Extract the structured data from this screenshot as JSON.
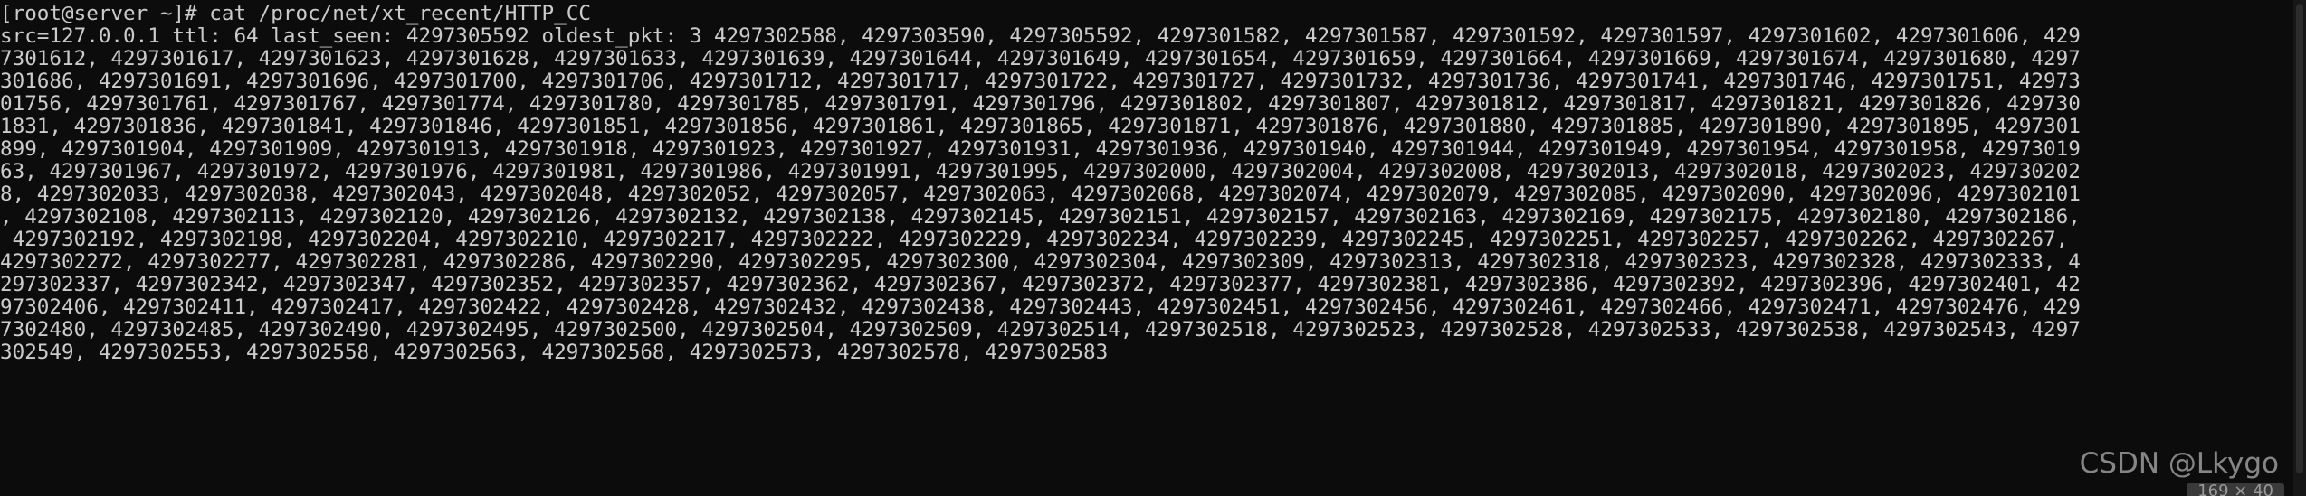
{
  "terminal": {
    "lines": [
      "[root@server ~]# cat /proc/net/xt_recent/HTTP_CC",
      "src=127.0.0.1 ttl: 64 last_seen: 4297305592 oldest_pkt: 3 4297302588, 4297303590, 4297305592, 4297301582, 4297301587, 4297301592, 4297301597, 4297301602, 4297301606, 429",
      "7301612, 4297301617, 4297301623, 4297301628, 4297301633, 4297301639, 4297301644, 4297301649, 4297301654, 4297301659, 4297301664, 4297301669, 4297301674, 4297301680, 4297",
      "301686, 4297301691, 4297301696, 4297301700, 4297301706, 4297301712, 4297301717, 4297301722, 4297301727, 4297301732, 4297301736, 4297301741, 4297301746, 4297301751, 42973",
      "01756, 4297301761, 4297301767, 4297301774, 4297301780, 4297301785, 4297301791, 4297301796, 4297301802, 4297301807, 4297301812, 4297301817, 4297301821, 4297301826, 429730",
      "1831, 4297301836, 4297301841, 4297301846, 4297301851, 4297301856, 4297301861, 4297301865, 4297301871, 4297301876, 4297301880, 4297301885, 4297301890, 4297301895, 4297301",
      "899, 4297301904, 4297301909, 4297301913, 4297301918, 4297301923, 4297301927, 4297301931, 4297301936, 4297301940, 4297301944, 4297301949, 4297301954, 4297301958, 42973019",
      "63, 4297301967, 4297301972, 4297301976, 4297301981, 4297301986, 4297301991, 4297301995, 4297302000, 4297302004, 4297302008, 4297302013, 4297302018, 4297302023, 429730202",
      "8, 4297302033, 4297302038, 4297302043, 4297302048, 4297302052, 4297302057, 4297302063, 4297302068, 4297302074, 4297302079, 4297302085, 4297302090, 4297302096, 4297302101",
      ", 4297302108, 4297302113, 4297302120, 4297302126, 4297302132, 4297302138, 4297302145, 4297302151, 4297302157, 4297302163, 4297302169, 4297302175, 4297302180, 4297302186,",
      " 4297302192, 4297302198, 4297302204, 4297302210, 4297302217, 4297302222, 4297302229, 4297302234, 4297302239, 4297302245, 4297302251, 4297302257, 4297302262, 4297302267,",
      "4297302272, 4297302277, 4297302281, 4297302286, 4297302290, 4297302295, 4297302300, 4297302304, 4297302309, 4297302313, 4297302318, 4297302323, 4297302328, 4297302333, 4",
      "297302337, 4297302342, 4297302347, 4297302352, 4297302357, 4297302362, 4297302367, 4297302372, 4297302377, 4297302381, 4297302386, 4297302392, 4297302396, 4297302401, 42",
      "97302406, 4297302411, 4297302417, 4297302422, 4297302428, 4297302432, 4297302438, 4297302443, 4297302451, 4297302456, 4297302461, 4297302466, 4297302471, 4297302476, 429",
      "7302480, 4297302485, 4297302490, 4297302495, 4297302500, 4297302504, 4297302509, 4297302514, 4297302518, 4297302523, 4297302528, 4297302533, 4297302538, 4297302543, 4297",
      "302549, 4297302553, 4297302558, 4297302563, 4297302568, 4297302573, 4297302578, 4297302583"
    ],
    "colors": {
      "background": "#0c0c0c",
      "foreground": "#cccccc"
    }
  },
  "watermark": "CSDN @Lkygo",
  "size_indicator": "169 × 40"
}
